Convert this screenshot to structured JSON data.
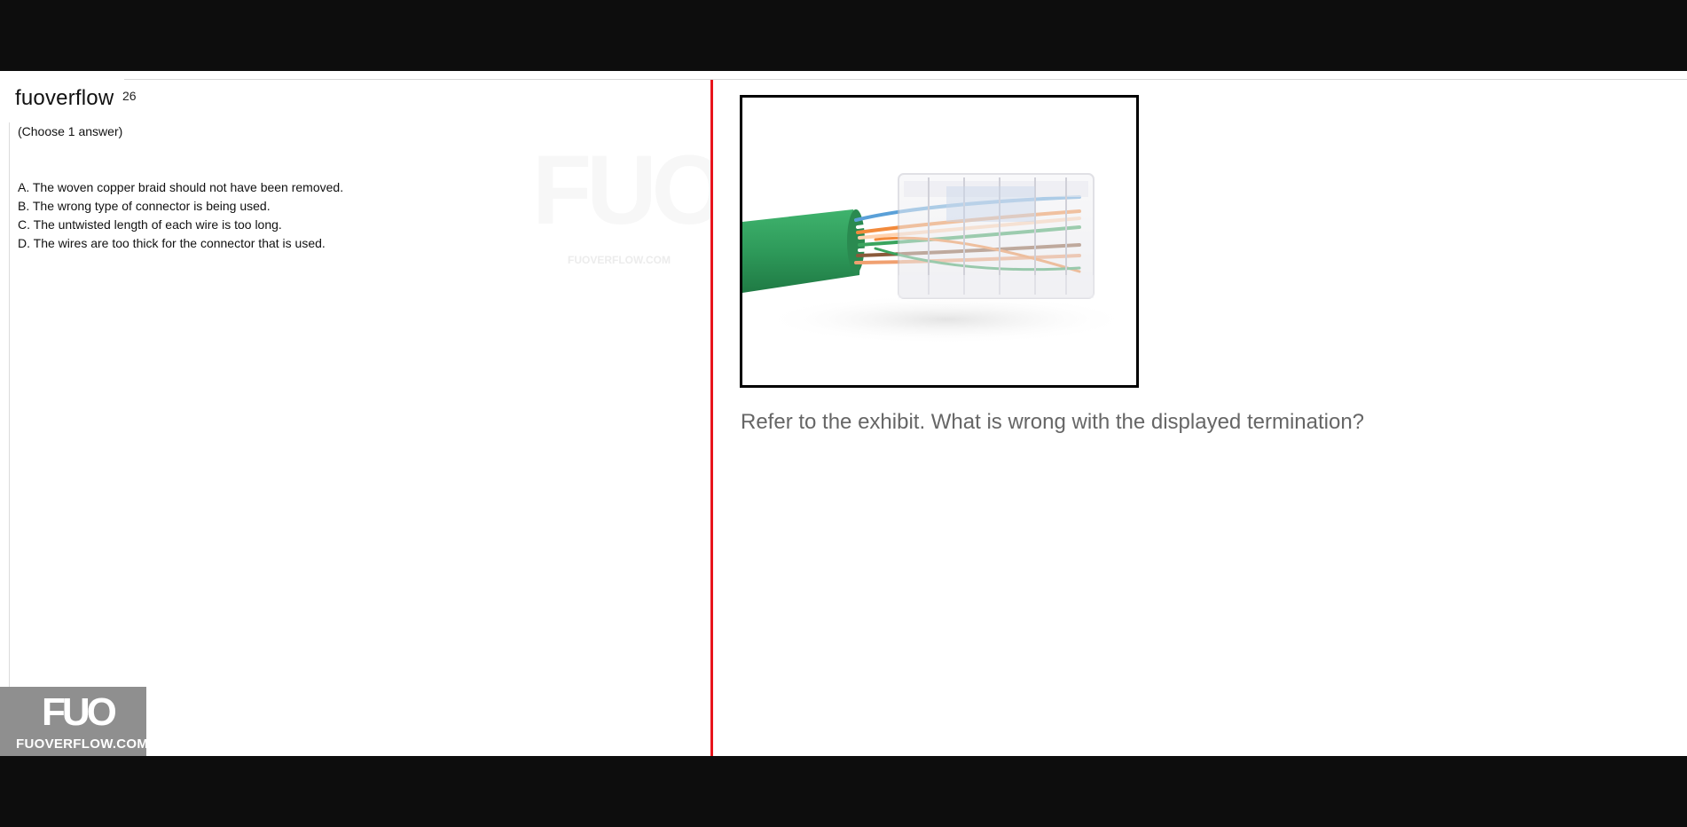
{
  "header": {
    "brand": "fuoverflow",
    "question_number_fragment": "26"
  },
  "question": {
    "instruction": "(Choose 1 answer)",
    "answers": [
      "A. The woven copper braid should not have been removed.",
      "B. The wrong type of connector is being used.",
      "C. The untwisted length of each wire is too long.",
      "D. The wires are too thick for the connector that is used."
    ],
    "prompt": "Refer to the exhibit. What is wrong with the displayed termination?"
  },
  "watermark": {
    "mark": "FUO",
    "site": "FUOVERFLOW.COM"
  },
  "logo": {
    "mark": "FUO",
    "site": "FUOVERFLOW.COM"
  },
  "colors": {
    "divider": "#e8141c",
    "cable_green": "#2e9a5a",
    "logo_bg": "#8f8f8f"
  }
}
